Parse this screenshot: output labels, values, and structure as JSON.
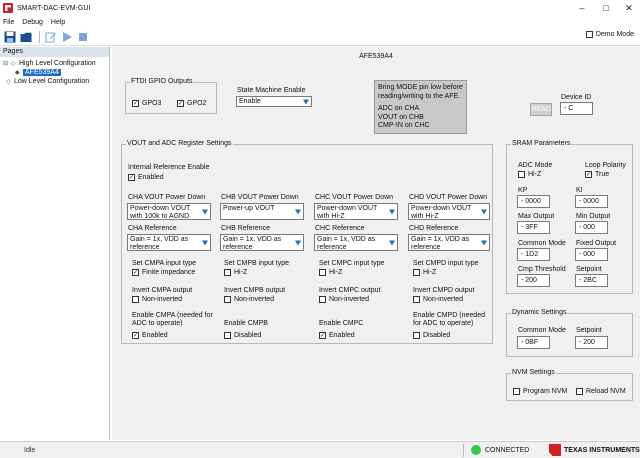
{
  "window": {
    "title": "SMART-DAC-EVM-GUI"
  },
  "menu": {
    "file": "File",
    "debug": "Debug",
    "help": "Help"
  },
  "toolbar": {
    "demo_mode": "Demo Mode",
    "demo_mode_checked": false
  },
  "pages": {
    "header": "Pages",
    "items": [
      "High Level Configuration",
      "AFE539A4",
      "Low Level Configuration"
    ]
  },
  "main": {
    "title": "AFE539A4"
  },
  "ftdi": {
    "title": "FTDI GPIO Outputs",
    "gpio3": "GPO3",
    "gpio2": "GPO2",
    "gpio3_checked": true,
    "gpio2_checked": true
  },
  "state_machine": {
    "label": "State Machine Enable",
    "value": "Enable"
  },
  "note": {
    "line1": "Bring MODE pin low before",
    "line2": "reading/writing to the AFE.",
    "line3": "ADC on CHA",
    "line4": "VOUT on CHB",
    "line5": "CMP-IN on CHC"
  },
  "device": {
    "read_label": "READ",
    "id_label": "Device ID",
    "id_value": "- C"
  },
  "vout": {
    "title": "VOUT and ADC Register Settings",
    "int_ref_label": "Internal Reference Enable",
    "int_ref_value": "Enabled",
    "int_ref_checked": true,
    "channels": [
      {
        "pd_label": "CHA VOUT Power Down",
        "pd_value": "Power-down VOUT with 100k to AGND",
        "ref_label": "CHA Reference",
        "ref_value": "Gain = 1x, VDD as reference",
        "cmp_type_label": "Set CMPA input type",
        "cmp_type_value": "Finite impedance",
        "cmp_type_checked": true,
        "cmp_out_label": "Invert CMPA output",
        "cmp_out_value": "Non-inverted",
        "cmp_out_checked": false,
        "en_label": "Enable CMPA (needed for ADC to operate)",
        "en_value": "Enabled",
        "en_checked": true
      },
      {
        "pd_label": "CHB VOUT Power Down",
        "pd_value": "Power-up VOUT",
        "ref_label": "CHB Reference",
        "ref_value": "Gain = 1x, VDD as reference",
        "cmp_type_label": "Set CMPB input type",
        "cmp_type_value": "Hi-Z",
        "cmp_type_checked": false,
        "cmp_out_label": "Invert CMPB output",
        "cmp_out_value": "Non-inverted",
        "cmp_out_checked": false,
        "en_label": "Enable CMPB",
        "en_value": "Disabled",
        "en_checked": false
      },
      {
        "pd_label": "CHC VOUT Power Down",
        "pd_value": "Power-down VOUT with Hi-Z",
        "ref_label": "CHC Reference",
        "ref_value": "Gain = 1x, VDD as reference",
        "cmp_type_label": "Set CMPC input type",
        "cmp_type_value": "Hi-Z",
        "cmp_type_checked": false,
        "cmp_out_label": "Invert CMPC output",
        "cmp_out_value": "Non-inverted",
        "cmp_out_checked": false,
        "en_label": "Enable CMPC",
        "en_value": "Enabled",
        "en_checked": true
      },
      {
        "pd_label": "CHD VOUT Power Down",
        "pd_value": "Power-down VOUT with Hi-Z",
        "ref_label": "CHD Reference",
        "ref_value": "Gain = 1x, VDD as reference",
        "cmp_type_label": "Set CMPD input type",
        "cmp_type_value": "Hi-Z",
        "cmp_type_checked": false,
        "cmp_out_label": "Invert CMPD output",
        "cmp_out_value": "Non-inverted",
        "cmp_out_checked": false,
        "en_label": "Enable CMPD (needed for ADC to operate)",
        "en_value": "Disabled",
        "en_checked": false
      }
    ]
  },
  "sram": {
    "title": "SRAM Parameters",
    "adc_mode_label": "ADC Mode",
    "adc_mode_value": "Hi-Z",
    "adc_mode_checked": false,
    "loop_pol_label": "Loop Polarity",
    "loop_pol_value": "True",
    "loop_pol_checked": true,
    "kp_label": "KP",
    "kp_value": "- 0000",
    "ki_label": "KI",
    "ki_value": "- 0000",
    "max_out_label": "Max Output",
    "max_out_value": "- 3FF",
    "min_out_label": "Min Output",
    "min_out_value": "- 000",
    "common_mode_label": "Common Mode",
    "common_mode_value": "- 1D2",
    "fixed_out_label": "Fixed Output",
    "fixed_out_value": "- 000",
    "cmp_thresh_label": "Cmp Threshold",
    "cmp_thresh_value": "- 200",
    "setpoint_label": "Setpoint",
    "setpoint_value": "- 2BC"
  },
  "dynamic": {
    "title": "Dynamic Settings",
    "common_mode_label": "Common Mode",
    "common_mode_value": "- 0BF",
    "setpoint_label": "Setpoint",
    "setpoint_value": "- 200"
  },
  "nvm": {
    "title": "NVM Settings",
    "program_label": "Program NVM",
    "reload_label": "Reload NVM"
  },
  "status": {
    "idle": "Idle",
    "connection": "CONNECTED",
    "brand": "TEXAS INSTRUMENTS"
  },
  "colors": {
    "accent": "#1a6fc7",
    "connected": "#2ecc40",
    "brand": "#cc2222",
    "panel": "#f0f0f0"
  }
}
